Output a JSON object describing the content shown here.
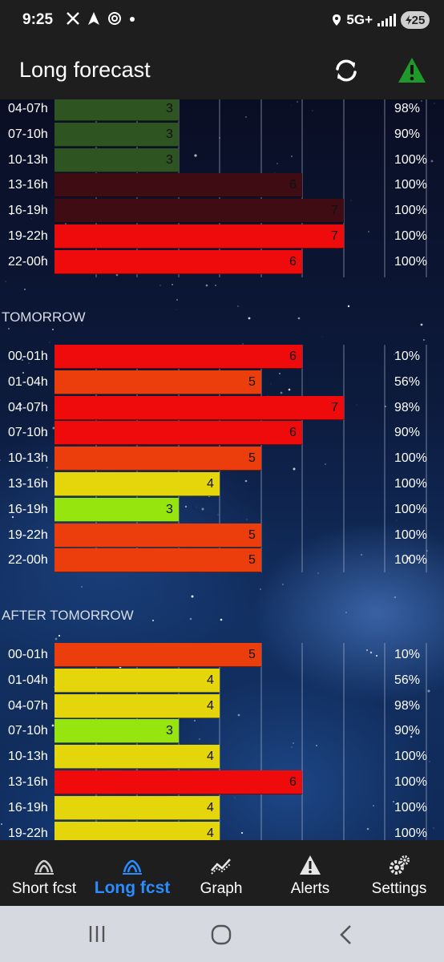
{
  "status_bar": {
    "time": "9:25",
    "left_icons": [
      "x-icon",
      "navigation-icon",
      "threads-icon",
      "dot-icon"
    ],
    "network": "5G+",
    "battery": "25"
  },
  "header": {
    "title": "Long forecast",
    "refresh_icon": "refresh-icon",
    "alert_icon": "alert-triangle-icon",
    "alert_color": "#1f9a2a"
  },
  "forecast": {
    "today": [
      {
        "time": "04-07h",
        "value": "3",
        "percent": "98%",
        "color": "#2e5422"
      },
      {
        "time": "07-10h",
        "value": "3",
        "percent": "90%",
        "color": "#2e5422"
      },
      {
        "time": "10-13h",
        "value": "3",
        "percent": "100%",
        "color": "#2e5422"
      },
      {
        "time": "13-16h",
        "value": "6",
        "percent": "100%",
        "color": "#3e0c12"
      },
      {
        "time": "16-19h",
        "value": "7",
        "percent": "100%",
        "color": "#3e0c12"
      },
      {
        "time": "19-22h",
        "value": "7",
        "percent": "100%",
        "color": "#ef0b0b"
      },
      {
        "time": "22-00h",
        "value": "6",
        "percent": "100%",
        "color": "#ef0b0b"
      }
    ],
    "tomorrow_label": "TOMORROW",
    "tomorrow": [
      {
        "time": "00-01h",
        "value": "6",
        "percent": "10%",
        "color": "#ef0b0b"
      },
      {
        "time": "01-04h",
        "value": "5",
        "percent": "56%",
        "color": "#ec3d0c"
      },
      {
        "time": "04-07h",
        "value": "7",
        "percent": "98%",
        "color": "#ef0b0b"
      },
      {
        "time": "07-10h",
        "value": "6",
        "percent": "90%",
        "color": "#ef0b0b"
      },
      {
        "time": "10-13h",
        "value": "5",
        "percent": "100%",
        "color": "#ec3d0c"
      },
      {
        "time": "13-16h",
        "value": "4",
        "percent": "100%",
        "color": "#e4d60a"
      },
      {
        "time": "16-19h",
        "value": "3",
        "percent": "100%",
        "color": "#96e50e"
      },
      {
        "time": "19-22h",
        "value": "5",
        "percent": "100%",
        "color": "#ec3d0c"
      },
      {
        "time": "22-00h",
        "value": "5",
        "percent": "100%",
        "color": "#ec3d0c"
      }
    ],
    "after_label": "AFTER TOMORROW",
    "after_tomorrow": [
      {
        "time": "00-01h",
        "value": "5",
        "percent": "10%",
        "color": "#ec3d0c"
      },
      {
        "time": "01-04h",
        "value": "4",
        "percent": "56%",
        "color": "#e4d60a"
      },
      {
        "time": "04-07h",
        "value": "4",
        "percent": "98%",
        "color": "#e4d60a"
      },
      {
        "time": "07-10h",
        "value": "3",
        "percent": "90%",
        "color": "#96e50e"
      },
      {
        "time": "10-13h",
        "value": "4",
        "percent": "100%",
        "color": "#e4d60a"
      },
      {
        "time": "13-16h",
        "value": "6",
        "percent": "100%",
        "color": "#ef0b0b"
      },
      {
        "time": "16-19h",
        "value": "4",
        "percent": "100%",
        "color": "#e4d60a"
      },
      {
        "time": "19-22h",
        "value": "4",
        "percent": "100%",
        "color": "#e4d60a"
      }
    ]
  },
  "bottom_nav": [
    {
      "label": "Short fcst",
      "icon": "aurora-icon",
      "active": false
    },
    {
      "label": "Long fcst",
      "icon": "aurora-icon",
      "active": true
    },
    {
      "label": "Graph",
      "icon": "graph-icon",
      "active": false
    },
    {
      "label": "Alerts",
      "icon": "alert-triangle-icon",
      "active": false
    },
    {
      "label": "Settings",
      "icon": "gears-icon",
      "active": false
    }
  ],
  "system_nav": [
    "recents-icon",
    "home-icon",
    "back-icon"
  ]
}
